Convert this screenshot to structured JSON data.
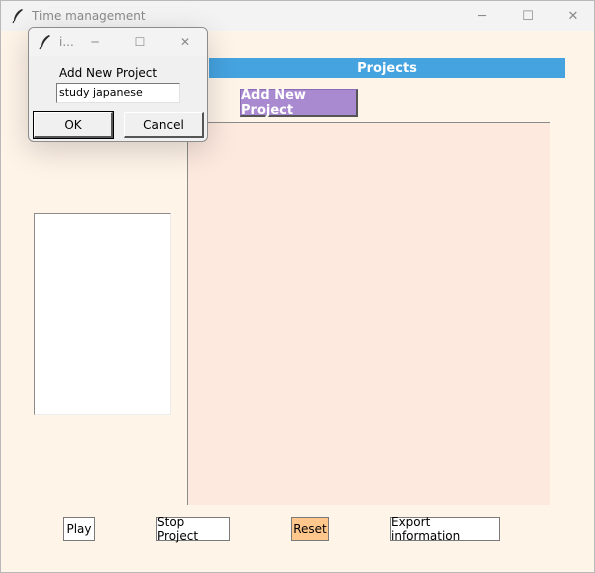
{
  "window": {
    "title": "Time management",
    "icon": "feather-icon",
    "controls": {
      "minimize": "─",
      "maximize": "☐",
      "close": "✕"
    }
  },
  "header": {
    "title": "Projects",
    "color": "#45a3e0"
  },
  "add_project_button": {
    "label": "Add New Project",
    "color": "#a98ad0"
  },
  "bottom_buttons": {
    "play": "Play",
    "stop": "Stop Project",
    "reset": "Reset",
    "export": "Export information"
  },
  "colors": {
    "background": "#fff4e8",
    "canvas": "#fde9de",
    "reset": "#ffc78c"
  },
  "dialog": {
    "title": "i...",
    "icon": "feather-icon",
    "controls": {
      "minimize": "─",
      "maximize": "☐",
      "close": "✕"
    },
    "prompt": "Add New Project",
    "input_value": "study japanese",
    "ok": "OK",
    "cancel": "Cancel"
  }
}
